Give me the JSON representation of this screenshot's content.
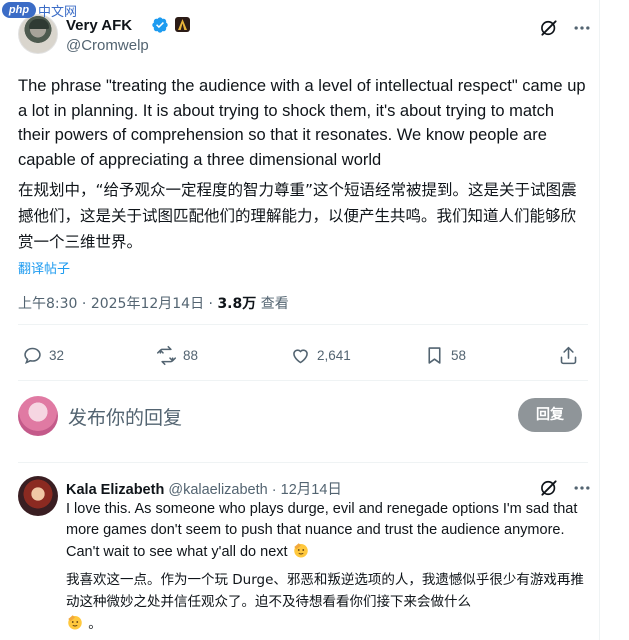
{
  "watermark": {
    "logo": "php",
    "text": "中文网"
  },
  "author": {
    "name": "Very AFK",
    "handle": "@Cromwelp",
    "verified": true,
    "badge_icon": "game-badge-icon"
  },
  "tweet": {
    "text_en": "The phrase \"treating the audience with a level of intellectual respect\" came up a lot in planning. It is about trying to shock them, it's about trying to match their powers of comprehension so that it resonates. We know people are capable of appreciating a three dimensional world",
    "text_zh": "在规划中，“给予观众一定程度的智力尊重”这个短语经常被提到。这是关于试图震撼他们，这是关于试图匹配他们的理解能力，以便产生共鸣。我们知道人们能够欣赏一个三维世界。",
    "translate_label": "翻译帖子",
    "time": "上午8:30",
    "date": "2025年12月14日",
    "views_count": "3.8万",
    "views_label": "查看"
  },
  "actions": {
    "replies": "32",
    "reposts": "88",
    "likes": "2,641",
    "bookmarks": "58"
  },
  "reply_box": {
    "placeholder": "发布你的回复",
    "button_label": "回复"
  },
  "reply": {
    "name": "Kala Elizabeth",
    "handle": "@kalaelizabeth",
    "separator": "·",
    "date": "12月14日",
    "text_en": "I love this. As someone who plays durge, evil and renegade options I'm sad that more games don't seem to push that nuance and trust the audience anymore. Can't wait to see what y'all do next",
    "text_zh": "我喜欢这一点。作为一个玩 Durge、邪恶和叛逆选项的人，我遗憾似乎很少有游戏再推动这种微妙之处并信任观众了。迫不及待想看看你们接下来会做什么",
    "text_zh_tail": "。"
  },
  "colors": {
    "text": "#0f1419",
    "muted": "#536471",
    "link": "#1d9bf0",
    "reply_button_bg": "#8f9599",
    "verified": "#1d9bf0"
  }
}
